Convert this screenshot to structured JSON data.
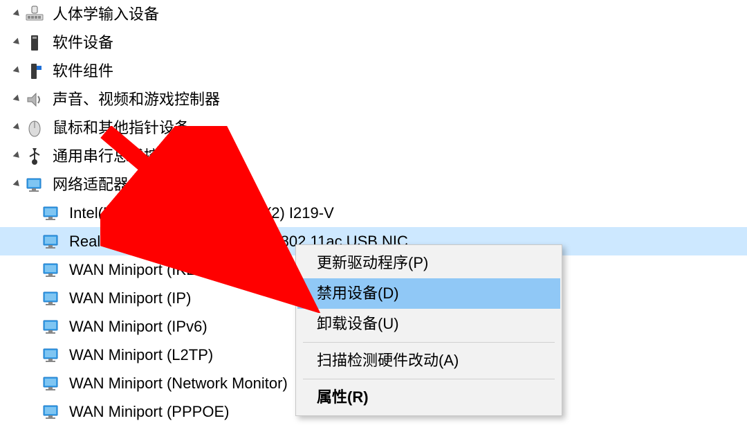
{
  "tree": {
    "items": [
      {
        "label": "人体学输入设备",
        "icon": "hid",
        "level": 1
      },
      {
        "label": "软件设备",
        "icon": "soft",
        "level": 1
      },
      {
        "label": "软件组件",
        "icon": "comp",
        "level": 1
      },
      {
        "label": "声音、视频和游戏控制器",
        "icon": "sound",
        "level": 1
      },
      {
        "label": "鼠标和其他指针设备",
        "icon": "mouse",
        "level": 1
      },
      {
        "label": "通用串行总线控制器",
        "icon": "usb",
        "level": 1
      },
      {
        "label": "网络适配器",
        "icon": "net",
        "level": 1,
        "expanded": true
      },
      {
        "label": "Intel(R) Ethernet Connection (2) I219-V",
        "icon": "net",
        "level": 2
      },
      {
        "label": "Realtek 8812BU Wireless LAN 802.11ac USB NIC",
        "icon": "net",
        "level": 2,
        "selected": true
      },
      {
        "label": "WAN Miniport (IKEv2)",
        "icon": "net",
        "level": 2
      },
      {
        "label": "WAN Miniport (IP)",
        "icon": "net",
        "level": 2
      },
      {
        "label": "WAN Miniport (IPv6)",
        "icon": "net",
        "level": 2
      },
      {
        "label": "WAN Miniport (L2TP)",
        "icon": "net",
        "level": 2
      },
      {
        "label": "WAN Miniport (Network Monitor)",
        "icon": "net",
        "level": 2
      },
      {
        "label": "WAN Miniport (PPPOE)",
        "icon": "net",
        "level": 2
      }
    ]
  },
  "context_menu": {
    "items": [
      {
        "label": "更新驱动程序(P)",
        "hover": false
      },
      {
        "label": "禁用设备(D)",
        "hover": true
      },
      {
        "label": "卸载设备(U)",
        "hover": false
      },
      {
        "sep": true
      },
      {
        "label": "扫描检测硬件改动(A)",
        "hover": false
      },
      {
        "sep": true
      },
      {
        "label": "属性(R)",
        "bold": true
      }
    ]
  },
  "annotation": {
    "arrow_color": "#ff0000"
  }
}
